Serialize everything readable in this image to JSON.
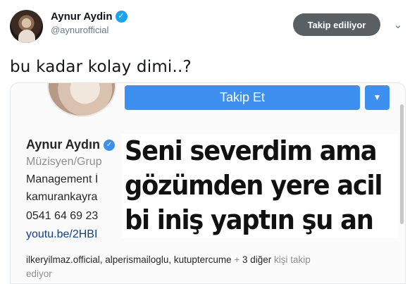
{
  "tweet": {
    "display_name": "Aynur Aydin",
    "handle": "@aynurofficial",
    "follow_button": "Takip ediliyor",
    "text": "bu kadar kolay dimi..?",
    "verified_glyph": "✓",
    "menu_glyph": "⌄"
  },
  "photo": {
    "follow_button": "Takip Et",
    "dropdown_glyph": "▼",
    "profile_name": "Aynur Aydın",
    "bio": [
      "Müzisyen/Grup",
      "Management İ",
      "kamurankayra",
      "0541 64 69 23",
      "youtu.be/2HBI"
    ],
    "overlay_lines": [
      "Seni severdim ama",
      "gözümden yere acil",
      "bi iniş yaptın şu an"
    ],
    "followed_by": {
      "names": "ilkeryilmaz.official, alperismailoglu, kutuptercume",
      "plus": " + ",
      "others": "3 diğer",
      "suffix": " kişi takip",
      "line2": "ediyor"
    }
  },
  "colors": {
    "twitter_blue": "#1da1f2",
    "instagram_blue": "#3d8ff0",
    "follow_button_bg": "#5a5f64"
  }
}
